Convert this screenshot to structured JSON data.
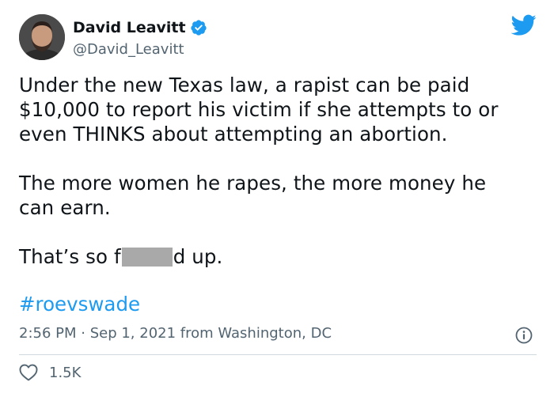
{
  "author": {
    "name": "David Leavitt",
    "handle": "@David_Leavitt",
    "avatar_icon": "profile-photo",
    "verified_icon": "verified-badge-icon"
  },
  "platform_icon": "twitter-bird-icon",
  "tweet": {
    "line1": "Under the new Texas law, a rapist can be paid",
    "line2": "$10,000 to report his victim if she attempts to or",
    "line3": "even THINKS about attempting an abortion.",
    "line4": "The more women he rapes, the more money he",
    "line5": "can earn.",
    "line6_start": "That’s so f",
    "line6_end": "d up.",
    "hashtag": "#roevswade"
  },
  "meta": {
    "timestamp": "2:56 PM · Sep 1, 2021 from Washington, DC"
  },
  "engagement": {
    "likes": "1.5K"
  },
  "colors": {
    "link": "#1d9bf0",
    "secondary_text": "#536471",
    "censor_block": "#a9a9a9"
  }
}
